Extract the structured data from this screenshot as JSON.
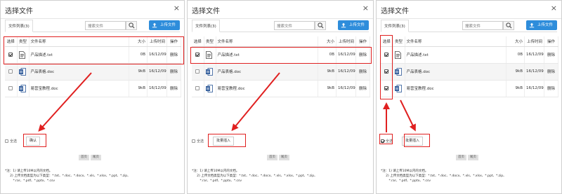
{
  "dialog": {
    "title": "选择文件",
    "close_label": "×",
    "tab_label": "文件列表(3)",
    "search_placeholder": "搜索文件",
    "upload_label": "上传文件"
  },
  "table": {
    "headers": {
      "select": "选择",
      "type": "类型",
      "name": "文件名称",
      "size": "大小",
      "time": "上传时间",
      "op": "操作"
    },
    "rows": [
      {
        "name": "产品描述.txt",
        "size": "0B",
        "time": "16/12/09",
        "op": "删除",
        "filetype": "txt"
      },
      {
        "name": "产品表格.doc",
        "size": "9kB",
        "time": "16/12/09",
        "op": "删除",
        "filetype": "doc"
      },
      {
        "name": "易营宝教程.doc",
        "size": "9kB",
        "time": "16/12/09",
        "op": "删除",
        "filetype": "doc"
      }
    ]
  },
  "panels": [
    {
      "checked": [
        true,
        false,
        false
      ],
      "select_all_checked": false,
      "select_all_label": "全选",
      "confirm_label": "确认"
    },
    {
      "checked": [
        true,
        false,
        false
      ],
      "select_all_checked": false,
      "select_all_label": "全选",
      "confirm_label": "批量插入"
    },
    {
      "checked": [
        true,
        true,
        true
      ],
      "select_all_checked": true,
      "select_all_label": "全选",
      "confirm_label": "批量插入"
    }
  ],
  "pager": {
    "prev": "首页",
    "next": "尾页"
  },
  "notes": {
    "line1": "*注：1) 请上传10M以内的文档。",
    "line2": "     2) 上传文档类型为以下类型：*.txt、*.doc、*.docx、*.xls、*.xlsx、*.ppt、*.zip、",
    "line3": "        *.rar、*.pdf、*.pptx、*.csv"
  },
  "colors": {
    "accent": "#2e8ddb",
    "highlight": "#e02020"
  }
}
